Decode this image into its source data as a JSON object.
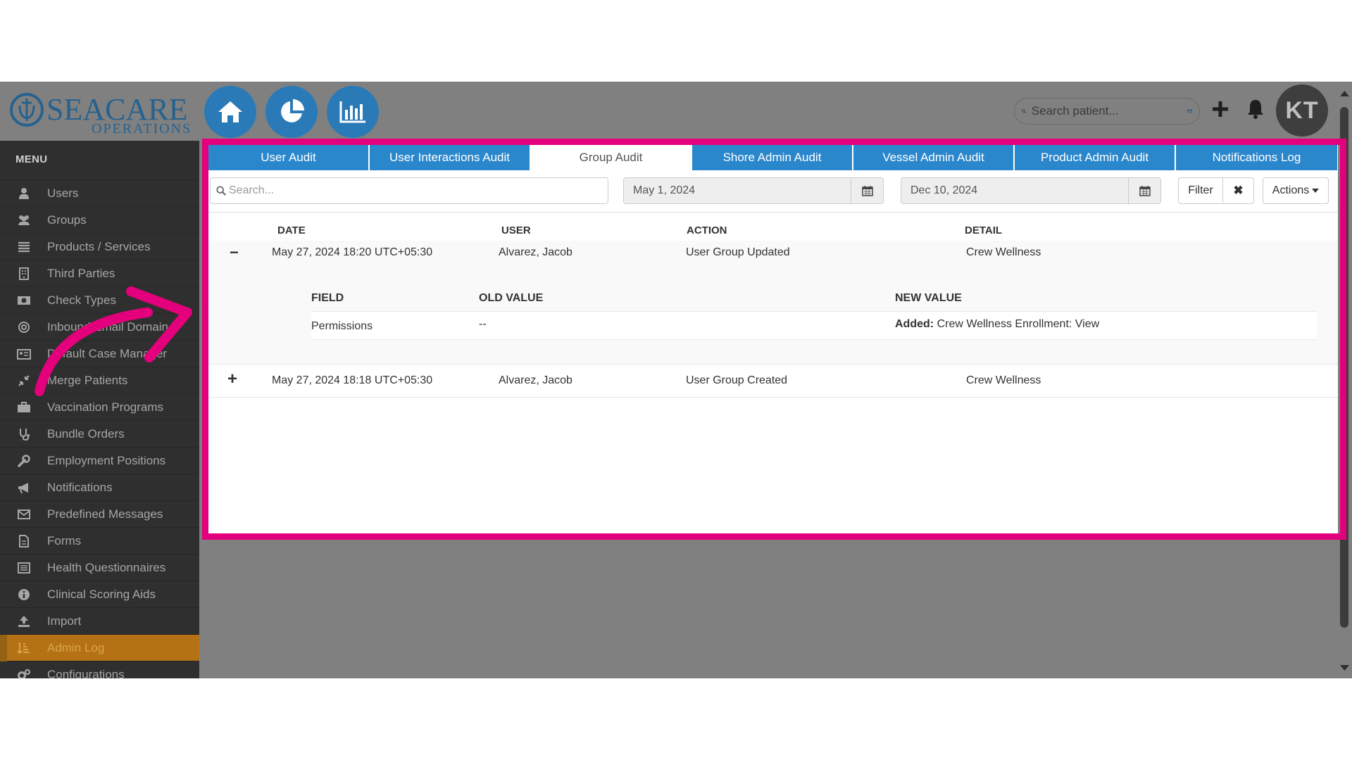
{
  "header": {
    "logo_text": "SEACARE",
    "logo_subtext": "OPERATIONS",
    "nav_icons": [
      "home-icon",
      "pie-chart-icon",
      "bar-chart-icon"
    ],
    "search_placeholder": "Search patient...",
    "avatar_initials": "KT"
  },
  "sidebar": {
    "title": "MENU",
    "items": [
      {
        "label": "Users",
        "icon": "user-icon"
      },
      {
        "label": "Groups",
        "icon": "users-icon"
      },
      {
        "label": "Products / Services",
        "icon": "list-icon"
      },
      {
        "label": "Third Parties",
        "icon": "building-icon"
      },
      {
        "label": "Check Types",
        "icon": "money-icon"
      },
      {
        "label": "Inbound Email Domain",
        "icon": "at-icon"
      },
      {
        "label": "Default Case Manager",
        "icon": "id-card-icon"
      },
      {
        "label": "Merge Patients",
        "icon": "compress-icon"
      },
      {
        "label": "Vaccination Programs",
        "icon": "briefcase-icon"
      },
      {
        "label": "Bundle Orders",
        "icon": "stethoscope-icon"
      },
      {
        "label": "Employment Positions",
        "icon": "wrench-icon"
      },
      {
        "label": "Notifications",
        "icon": "bullhorn-icon"
      },
      {
        "label": "Predefined Messages",
        "icon": "envelope-icon"
      },
      {
        "label": "Forms",
        "icon": "file-icon"
      },
      {
        "label": "Health Questionnaires",
        "icon": "list-alt-icon"
      },
      {
        "label": "Clinical Scoring Aids",
        "icon": "info-circle-icon"
      },
      {
        "label": "Import",
        "icon": "upload-icon"
      },
      {
        "label": "Admin Log",
        "icon": "sort-amount-icon",
        "active": true
      },
      {
        "label": "Configurations",
        "icon": "cogs-icon"
      }
    ]
  },
  "tabs": [
    {
      "label": "User Audit"
    },
    {
      "label": "User Interactions Audit"
    },
    {
      "label": "Group Audit",
      "active": true
    },
    {
      "label": "Shore Admin Audit"
    },
    {
      "label": "Vessel Admin Audit"
    },
    {
      "label": "Product Admin Audit"
    },
    {
      "label": "Notifications Log"
    }
  ],
  "filters": {
    "search_placeholder": "Search...",
    "date_from": "May 1, 2024",
    "date_to": "Dec 10, 2024",
    "filter_label": "Filter",
    "clear_label": "✖",
    "actions_label": "Actions"
  },
  "table": {
    "columns": [
      "DATE",
      "USER",
      "ACTION",
      "DETAIL"
    ],
    "rows": [
      {
        "toggle": "−",
        "date": "May 27, 2024 18:20 UTC+05:30",
        "user": "Alvarez, Jacob",
        "action": "User Group Updated",
        "detail": "Crew Wellness",
        "expanded": true,
        "changes": {
          "columns": [
            "FIELD",
            "OLD VALUE",
            "NEW VALUE"
          ],
          "items": [
            {
              "field": "Permissions",
              "old_value": "--",
              "new_value_prefix": "Added:",
              "new_value": "Crew Wellness Enrollment: View"
            }
          ]
        }
      },
      {
        "toggle": "+",
        "date": "May 27, 2024 18:18 UTC+05:30",
        "user": "Alvarez, Jacob",
        "action": "User Group Created",
        "detail": "Crew Wellness",
        "expanded": false
      }
    ]
  },
  "colors": {
    "highlight": "#e4007c",
    "tab_blue": "#2b87cc",
    "active_menu": "#b57214"
  }
}
